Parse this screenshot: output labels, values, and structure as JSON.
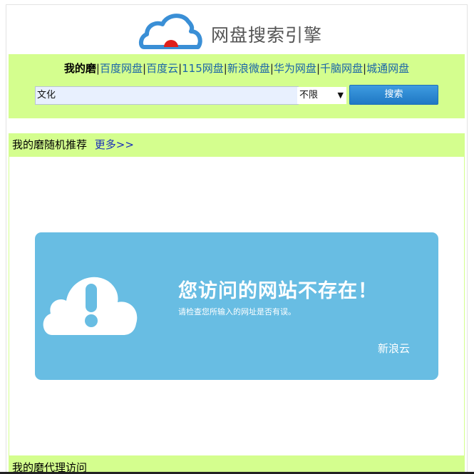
{
  "header": {
    "title": "网盘搜索引擎"
  },
  "nav": {
    "current": "我的磨",
    "links": [
      "百度网盘",
      "百度云",
      "115网盘",
      "新浪微盘",
      "华为网盘",
      "千脑网盘",
      "城通网盘"
    ]
  },
  "search": {
    "value": "文化",
    "filter_selected": "不限",
    "button_label": "搜索"
  },
  "recommend": {
    "heading": "我的磨随机推荐",
    "more_link": "更多>>"
  },
  "error": {
    "title": "您访问的网站不存在！",
    "subtitle": "请检查您所输入的网址是否有误。",
    "brand": "新浪云"
  },
  "proxy": {
    "heading": "我的磨代理访问"
  },
  "colors": {
    "panel_green": "#d4fe8e",
    "card_blue": "#68bde3",
    "button_blue": "#1f78c4",
    "link_blue": "#1a64a8"
  }
}
